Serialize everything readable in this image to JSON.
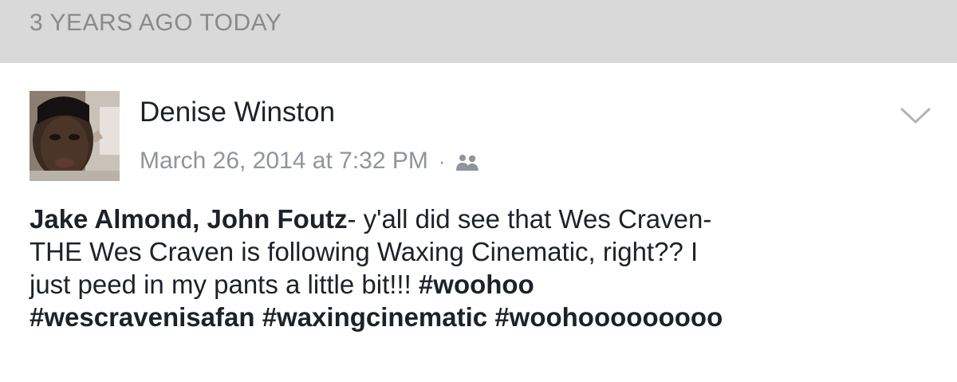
{
  "memory": {
    "header": "3 YEARS AGO TODAY"
  },
  "post": {
    "author": "Denise Winston",
    "timestamp": "March 26, 2014 at 7:32 PM",
    "separator": "·",
    "audience_icon": "friends-icon",
    "menu_icon": "chevron-down-icon",
    "tagged_1": "Jake Almond",
    "comma": ", ",
    "tagged_2": "John Foutz",
    "line1_rest": "- y'all did see that Wes Craven-",
    "line2": "THE Wes Craven is following Waxing Cinematic, right??  I",
    "line3_text": "just peed in my pants a little bit!!!  ",
    "hashtag_1": "#woohoo",
    "hashtag_2": "#wescravenisafan",
    "hashtag_3": "#waxingcinematic",
    "hashtag_4": "#woohooooooooo"
  },
  "colors": {
    "header_bg": "#d9d9d9",
    "header_text": "#8a8a8a",
    "name_text": "#1d2129",
    "meta_text": "#90949c"
  }
}
